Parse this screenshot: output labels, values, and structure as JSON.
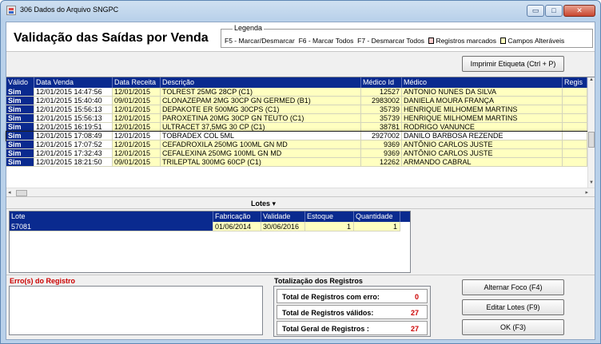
{
  "window": {
    "title": "306 Dados do Arquivo SNGPC",
    "minimize_glyph": "▭",
    "maximize_glyph": "□",
    "close_glyph": "✕"
  },
  "header": {
    "title": "Validação das Saídas por Venda",
    "legend": {
      "caption": "Legenda",
      "f5": "F5 - Marcar/Desmarcar",
      "f6": "F6 - Marcar Todos",
      "f7": "F7 - Desmarcar Todos",
      "marked": "Registros marcados",
      "editable": "Campos Alteráveis",
      "marked_color": "#ffcccc",
      "editable_color": "#ffffc0"
    }
  },
  "toolbar": {
    "print_label": "Imprimir Etiqueta (Ctrl + P)"
  },
  "grid": {
    "columns": [
      "Válido",
      "Data Venda",
      "Data Receita",
      "Descrição",
      "Médico Id",
      "Médico",
      "Regis"
    ],
    "rows": [
      {
        "valido": "Sim",
        "data_venda": "12/01/2015 14:47:56",
        "data_receita": "12/01/2015",
        "descricao": "TOLREST 25MG 28CP (C1)",
        "medico_id": "12527",
        "medico": "ANTONIO NUNES DA SILVA"
      },
      {
        "valido": "Sim",
        "data_venda": "12/01/2015 15:40:40",
        "data_receita": "09/01/2015",
        "descricao": "CLONAZEPAM 2MG 30CP GN GERMED (B1)",
        "medico_id": "2983002",
        "medico": "DANIELA MOURA FRANÇA"
      },
      {
        "valido": "Sim",
        "data_venda": "12/01/2015 15:56:13",
        "data_receita": "12/01/2015",
        "descricao": "DEPAKOTE ER 500MG 30CPS (C1)",
        "medico_id": "35739",
        "medico": "HENRIQUE MILHOMEM MARTINS"
      },
      {
        "valido": "Sim",
        "data_venda": "12/01/2015 15:56:13",
        "data_receita": "12/01/2015",
        "descricao": "PAROXETINA 20MG 30CP GN TEUTO (C1)",
        "medico_id": "35739",
        "medico": "HENRIQUE MILHOMEM MARTINS"
      },
      {
        "valido": "Sim",
        "data_venda": "12/01/2015 16:19:51",
        "data_receita": "12/01/2015",
        "descricao": "ULTRACET 37,5MG 30 CP (C1)",
        "medico_id": "38781",
        "medico": "RODRIGO VANUNCE"
      },
      {
        "valido": "Sim",
        "data_venda": "12/01/2015 17:08:49",
        "data_receita": "12/01/2015",
        "descricao": "TOBRADEX COL 5ML",
        "medico_id": "2927002",
        "medico": "DANILO BARBOSA REZENDE"
      },
      {
        "valido": "Sim",
        "data_venda": "12/01/2015 17:07:52",
        "data_receita": "12/01/2015",
        "descricao": "CEFADROXILA 250MG 100ML GN MD",
        "medico_id": "9369",
        "medico": "ANTÔNIO CARLOS JUSTE"
      },
      {
        "valido": "Sim",
        "data_venda": "12/01/2015 17:32:43",
        "data_receita": "12/01/2015",
        "descricao": "CEFALEXINA 250MG 100ML GN MD",
        "medico_id": "9369",
        "medico": "ANTÔNIO CARLOS JUSTE"
      },
      {
        "valido": "Sim",
        "data_venda": "12/01/2015 18:21:50",
        "data_receita": "09/01/2015",
        "descricao": "TRILEPTAL 300MG 60CP (C1)",
        "medico_id": "12262",
        "medico": "ARMANDO CABRAL"
      }
    ]
  },
  "lotes": {
    "title": "Lotes",
    "arrow": "▾",
    "columns": [
      "Lote",
      "Fabricação",
      "Validade",
      "Estoque",
      "Quantidade"
    ],
    "row": {
      "lote": "57081",
      "fabricacao": "01/06/2014",
      "validade": "30/06/2016",
      "estoque": "1",
      "quantidade": "1"
    }
  },
  "errors": {
    "label": "Erro(s) do Registro"
  },
  "totals": {
    "label": "Totalização dos Registros",
    "rows": [
      {
        "label": "Total de Registros com erro:",
        "value": "0"
      },
      {
        "label": "Total de Registros válidos:",
        "value": "27"
      },
      {
        "label": "Total Geral de Registros :",
        "value": "27"
      }
    ]
  },
  "actions": {
    "foco": "Alternar Foco (F4)",
    "lotes": "Editar Lotes (F9)",
    "ok": "OK (F3)"
  }
}
